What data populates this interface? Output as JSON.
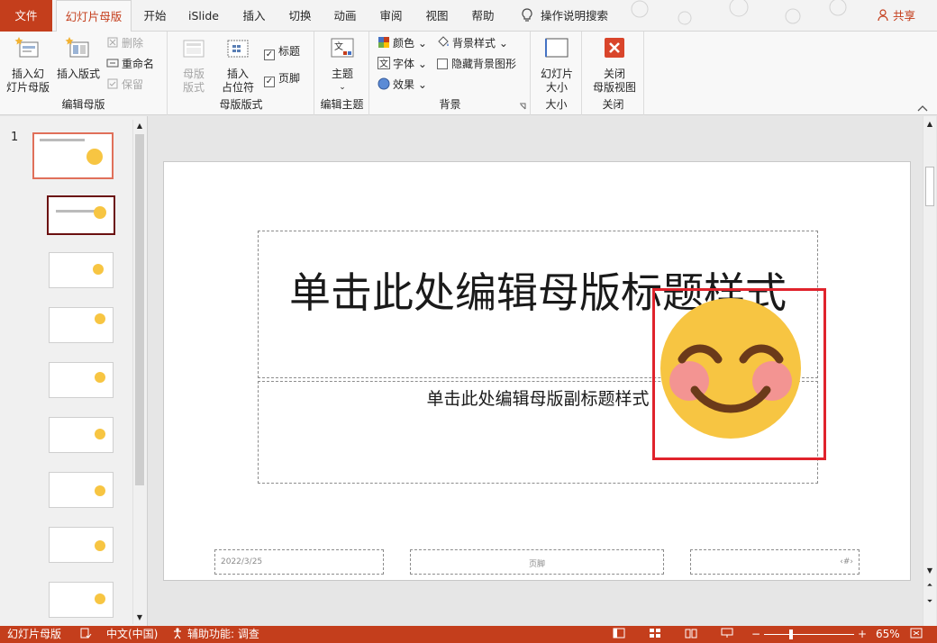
{
  "tabs": [
    "文件",
    "幻灯片母版",
    "开始",
    "iSlide",
    "插入",
    "切换",
    "动画",
    "审阅",
    "视图",
    "帮助"
  ],
  "search": {
    "label": "操作说明搜索"
  },
  "share": "共享",
  "ribbon": {
    "edit_master": {
      "label": "编辑母版",
      "insert_slide_master": "插入幻\n灯片母版",
      "insert_layout": "插入版式",
      "delete": "删除",
      "rename": "重命名",
      "preserve": "保留"
    },
    "master_layout": {
      "label": "母版版式",
      "master_layout_btn": "母版\n版式",
      "insert_placeholder": "插入\n占位符",
      "title_check": "标题",
      "footer_check": "页脚"
    },
    "edit_theme": {
      "label": "编辑主题",
      "theme": "主题"
    },
    "background": {
      "label": "背景",
      "colors": "颜色",
      "fonts": "字体",
      "effects": "效果",
      "bg_styles": "背景样式",
      "hide_bg": "隐藏背景图形"
    },
    "size": {
      "label": "大小",
      "slide_size": "幻灯片\n大小"
    },
    "close": {
      "label": "关闭",
      "close_master": "关闭\n母版视图"
    }
  },
  "thumbs": {
    "first_number": "1"
  },
  "slide": {
    "title": "单击此处编辑母版标题样式",
    "subtitle": "单击此处编辑母版副标题样式",
    "date": "2022/3/25",
    "footer": "页脚",
    "number": "‹#›"
  },
  "status": {
    "view": "幻灯片母版",
    "language": "中文(中国)",
    "accessibility": "辅助功能: 调查",
    "zoom": "65%"
  },
  "colors": {
    "accent": "#c43e1c",
    "highlight": "#e0232c",
    "emoji": "#f7c542"
  }
}
